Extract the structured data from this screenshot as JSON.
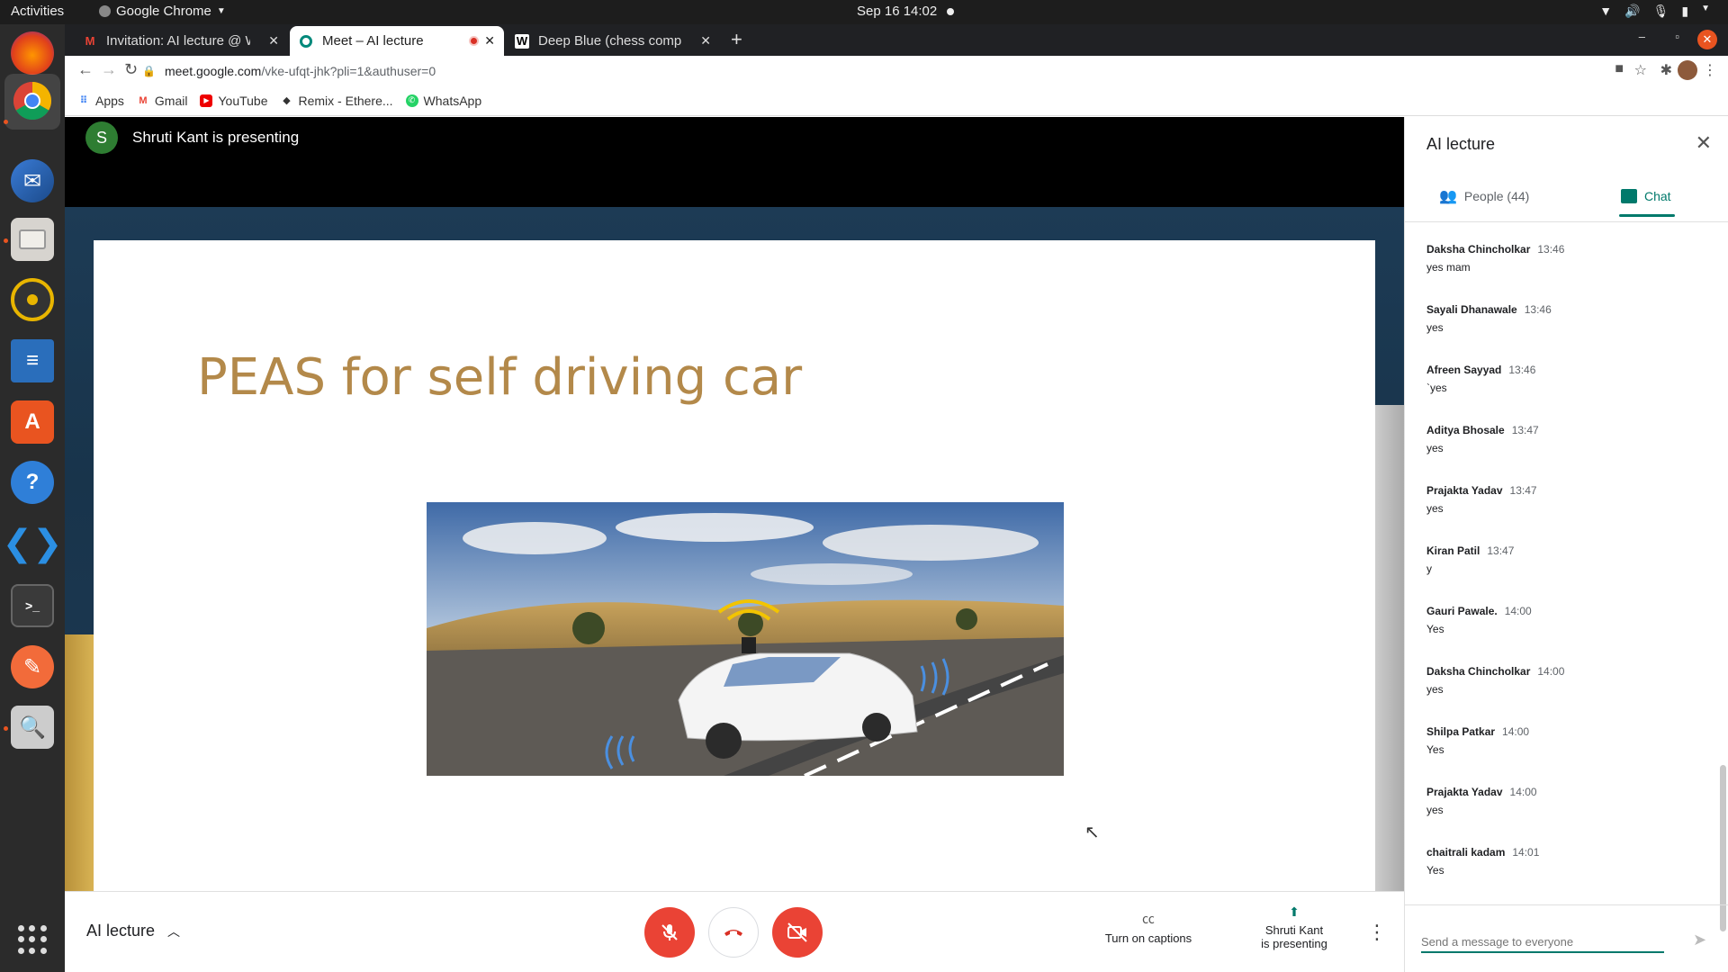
{
  "topbar": {
    "activities": "Activities",
    "app_name": "Google Chrome",
    "clock": "Sep 16  14:02"
  },
  "tabs": [
    {
      "title": "Invitation: AI lecture @ W",
      "icon": "gmail-icon"
    },
    {
      "title": "Meet – AI lecture",
      "icon": "meet-icon"
    },
    {
      "title": "Deep Blue (chess comput",
      "icon": "wikipedia-icon"
    }
  ],
  "omnibox": {
    "host": "meet.google.com",
    "path": "/vke-ufqt-jhk?pli=1&authuser=0"
  },
  "bookmarks": [
    {
      "label": "Apps",
      "icon": "apps-grid-icon"
    },
    {
      "label": "Gmail",
      "icon": "gmail-icon"
    },
    {
      "label": "YouTube",
      "icon": "youtube-icon"
    },
    {
      "label": "Remix - Ethere...",
      "icon": "remix-icon"
    },
    {
      "label": "WhatsApp",
      "icon": "whatsapp-icon"
    }
  ],
  "presenter": {
    "initial": "S",
    "text": "Shruti Kant is presenting"
  },
  "slide": {
    "title": "PEAS for self driving car"
  },
  "controls": {
    "meeting_name": "AI lecture",
    "captions_label": "Turn on captions",
    "presenting_line1": "Shruti Kant",
    "presenting_line2": "is presenting"
  },
  "side_panel": {
    "title": "AI lecture",
    "people_tab": "People (44)",
    "chat_tab": "Chat",
    "input_placeholder": "Send a message to everyone",
    "messages": [
      {
        "name": "Daksha Chincholkar",
        "time": "13:46",
        "text": "yes mam"
      },
      {
        "name": "Sayali Dhanawale",
        "time": "13:46",
        "text": "yes"
      },
      {
        "name": "Afreen Sayyad",
        "time": "13:46",
        "text": "`yes"
      },
      {
        "name": "Aditya Bhosale",
        "time": "13:47",
        "text": "yes"
      },
      {
        "name": "Prajakta Yadav",
        "time": "13:47",
        "text": "yes"
      },
      {
        "name": "Kiran Patil",
        "time": "13:47",
        "text": "y"
      },
      {
        "name": "Gauri Pawale.",
        "time": "14:00",
        "text": "Yes"
      },
      {
        "name": "Daksha Chincholkar",
        "time": "14:00",
        "text": "yes"
      },
      {
        "name": "Shilpa Patkar",
        "time": "14:00",
        "text": "Yes"
      },
      {
        "name": "Prajakta Yadav",
        "time": "14:00",
        "text": "yes"
      },
      {
        "name": "chaitrali kadam",
        "time": "14:01",
        "text": "Yes"
      }
    ]
  },
  "colors": {
    "meet_red": "#ea4335",
    "meet_green": "#00796b",
    "slide_title": "#b3894a"
  }
}
